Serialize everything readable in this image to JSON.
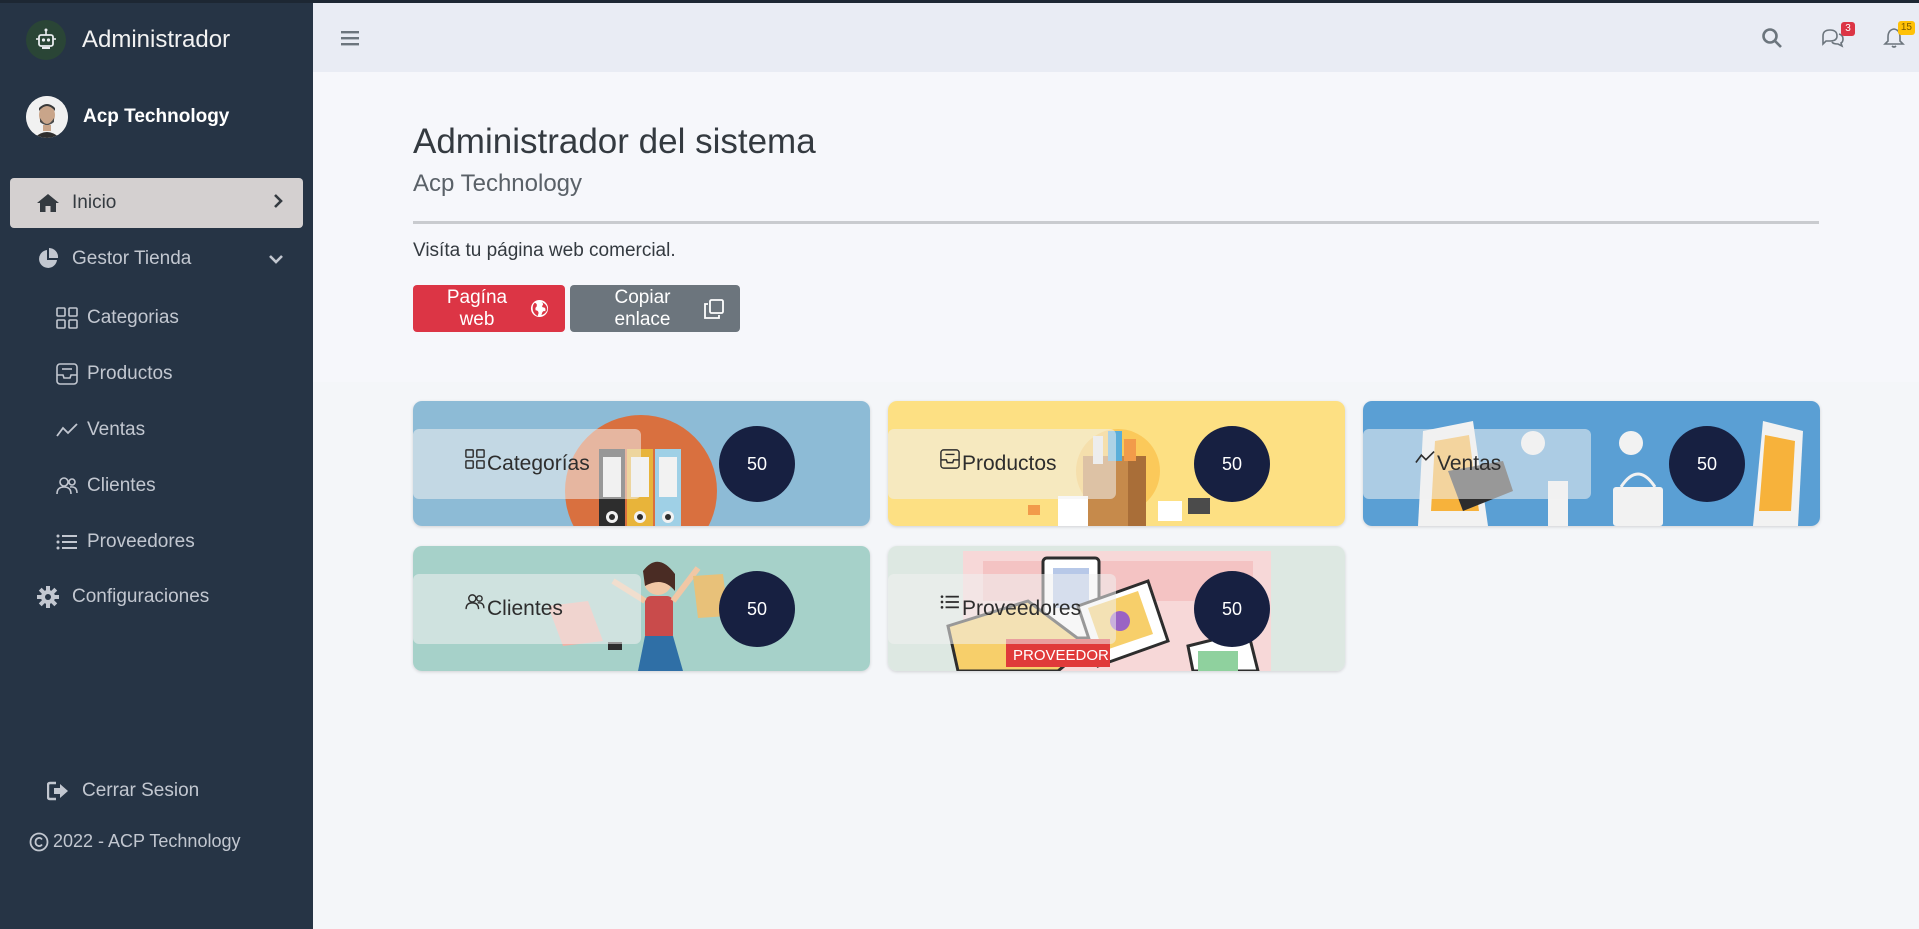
{
  "brand": {
    "title": "Administrador"
  },
  "user": {
    "name": "Acp Technology"
  },
  "sidebar": {
    "items": [
      {
        "label": "Inicio"
      },
      {
        "label": "Gestor Tienda"
      },
      {
        "label": "Categorias"
      },
      {
        "label": "Productos"
      },
      {
        "label": "Ventas"
      },
      {
        "label": "Clientes"
      },
      {
        "label": "Proveedores"
      },
      {
        "label": "Configuraciones"
      }
    ],
    "logout_label": "Cerrar Sesion",
    "copyright": "2022 - ACP Technology"
  },
  "topbar": {
    "messages_count": "3",
    "notifications_count": "15"
  },
  "header": {
    "title": "Administrador del sistema",
    "subtitle": "Acp Technology",
    "visit_text": "Visíta tu página web comercial.",
    "web_button": "Pagína web",
    "copy_button": "Copiar enlace"
  },
  "cards": [
    {
      "label": "Categorías",
      "count": "50"
    },
    {
      "label": "Productos",
      "count": "50"
    },
    {
      "label": "Ventas",
      "count": "50"
    },
    {
      "label": "Clientes",
      "count": "50"
    },
    {
      "label": "Proveedores",
      "count": "50"
    }
  ],
  "illustration_text": {
    "proveedor": "PROVEEDOR"
  },
  "colors": {
    "sidebar_bg": "#263445",
    "active_item": "#d4d0d0",
    "danger": "#dc3545",
    "secondary": "#6c757d",
    "count_circle": "#172041"
  }
}
